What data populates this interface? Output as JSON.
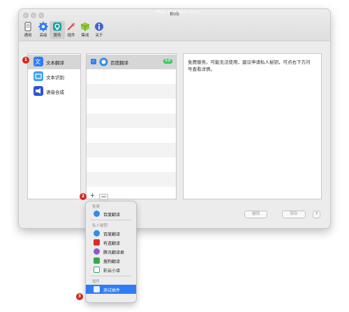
{
  "window": {
    "title": "Bob",
    "watermark": "Mac.orsoon.com"
  },
  "toolbar": [
    {
      "label": "通用",
      "icon": "phone-icon"
    },
    {
      "label": "高级",
      "icon": "gear-icon"
    },
    {
      "label": "服务",
      "icon": "service-icon",
      "selected": true
    },
    {
      "label": "插件",
      "icon": "plugin-icon"
    },
    {
      "label": "集成",
      "icon": "cube-icon"
    },
    {
      "label": "关于",
      "icon": "info-icon"
    }
  ],
  "services": [
    {
      "label": "文本翻译",
      "selected": true
    },
    {
      "label": "文本识别"
    },
    {
      "label": "语音合成"
    }
  ],
  "translators": {
    "rows": [
      {
        "name": "百度翻译",
        "badge": "免费",
        "checked": true
      }
    ]
  },
  "description": "免费服务。可能无法使用，建议申请私人秘钥，可点右下方问号查看详情。",
  "buttons": {
    "cancel": "撤销",
    "save": "保存",
    "help": "?",
    "add": "+",
    "remove": "−"
  },
  "markers": {
    "one": "1",
    "two": "2",
    "three": "3"
  },
  "menu": {
    "free_header": "免费",
    "free_items": [
      "百度翻译"
    ],
    "private_header": "私人秘钥",
    "private_items": [
      "百度翻译",
      "有道翻译",
      "腾讯翻译君",
      "搜狗翻译",
      "彩云小译"
    ],
    "plugin_header": "插件",
    "plugin_items": [
      "测试插件"
    ]
  },
  "colors": {
    "accent": "#2f7cf6",
    "marker": "#d9251c",
    "free_badge": "#35c659"
  }
}
